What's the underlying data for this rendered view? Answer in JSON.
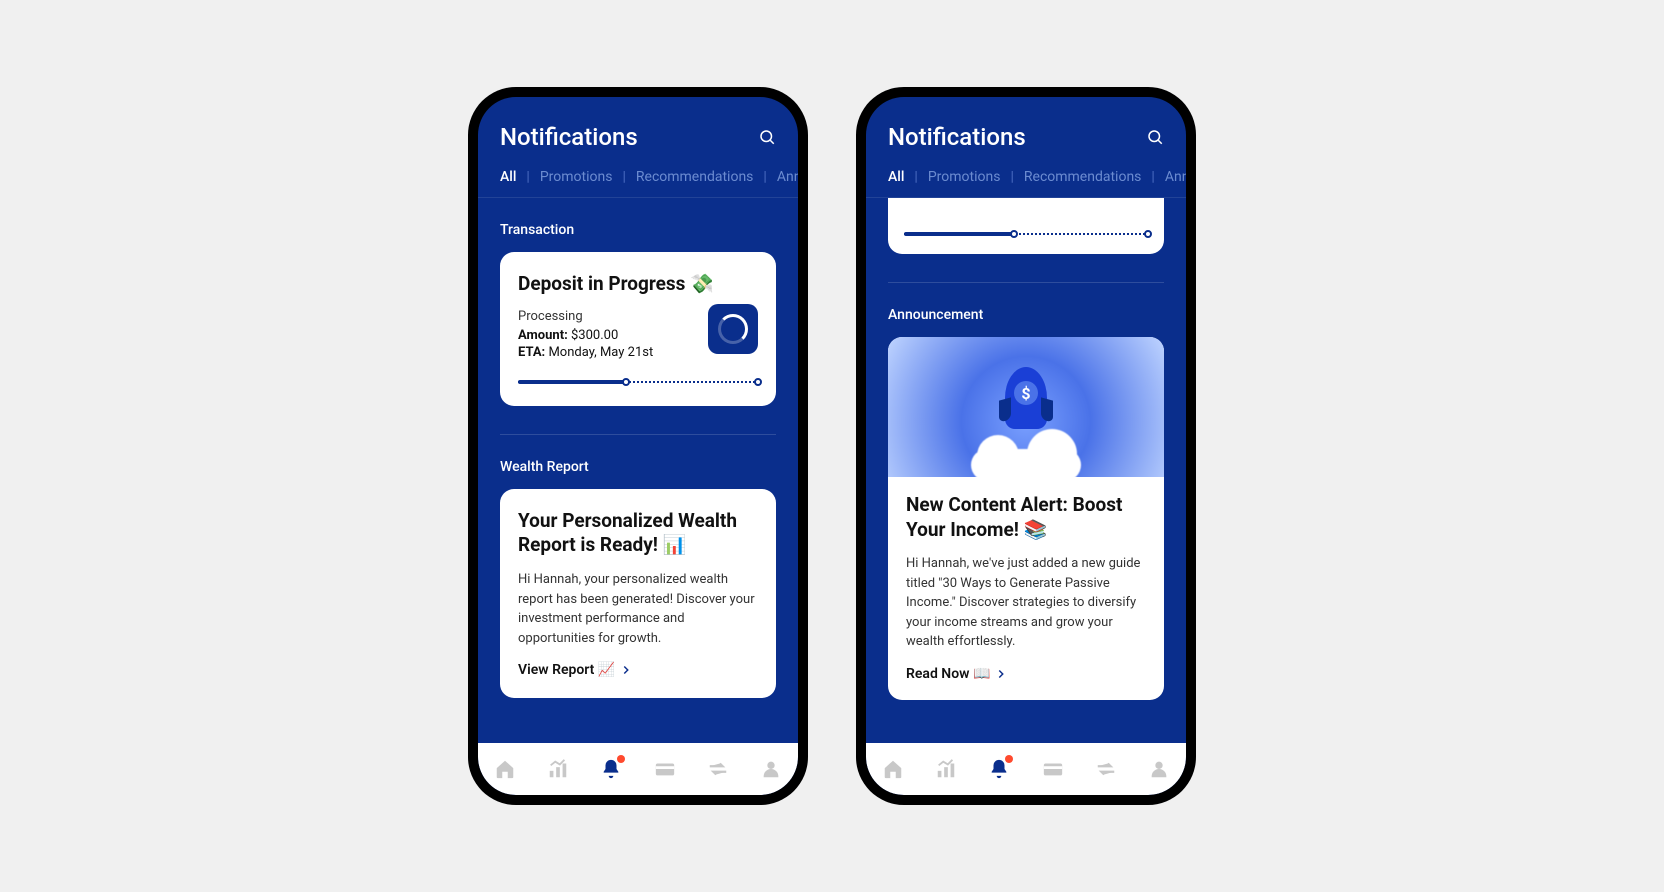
{
  "header": {
    "title": "Notifications"
  },
  "tabs": [
    "All",
    "Promotions",
    "Recommendations",
    "Ann…"
  ],
  "phone1": {
    "section1": {
      "label": "Transaction",
      "card": {
        "title": "Deposit in Progress 💸",
        "status": "Processing",
        "amountLabel": "Amount:",
        "amountValue": " $300.00",
        "etaLabel": "ETA:",
        "etaValue": " Monday, May 21st"
      }
    },
    "section2": {
      "label": "Wealth Report",
      "card": {
        "title": "Your Personalized Wealth Report is Ready! 📊",
        "body": "Hi Hannah, your personalized wealth report has been generated! Discover your investment performance and opportunities for growth.",
        "cta": "View Report 📈"
      }
    }
  },
  "phone2": {
    "section1": {
      "label": "Announcement",
      "card": {
        "title": "New Content Alert: Boost Your Income! 📚",
        "body": "Hi Hannah, we've just added a new guide titled \"30 Ways to Generate Passive Income.\" Discover strategies to diversify your income streams and grow your wealth effortlessly.",
        "cta": "Read Now 📖"
      }
    }
  }
}
